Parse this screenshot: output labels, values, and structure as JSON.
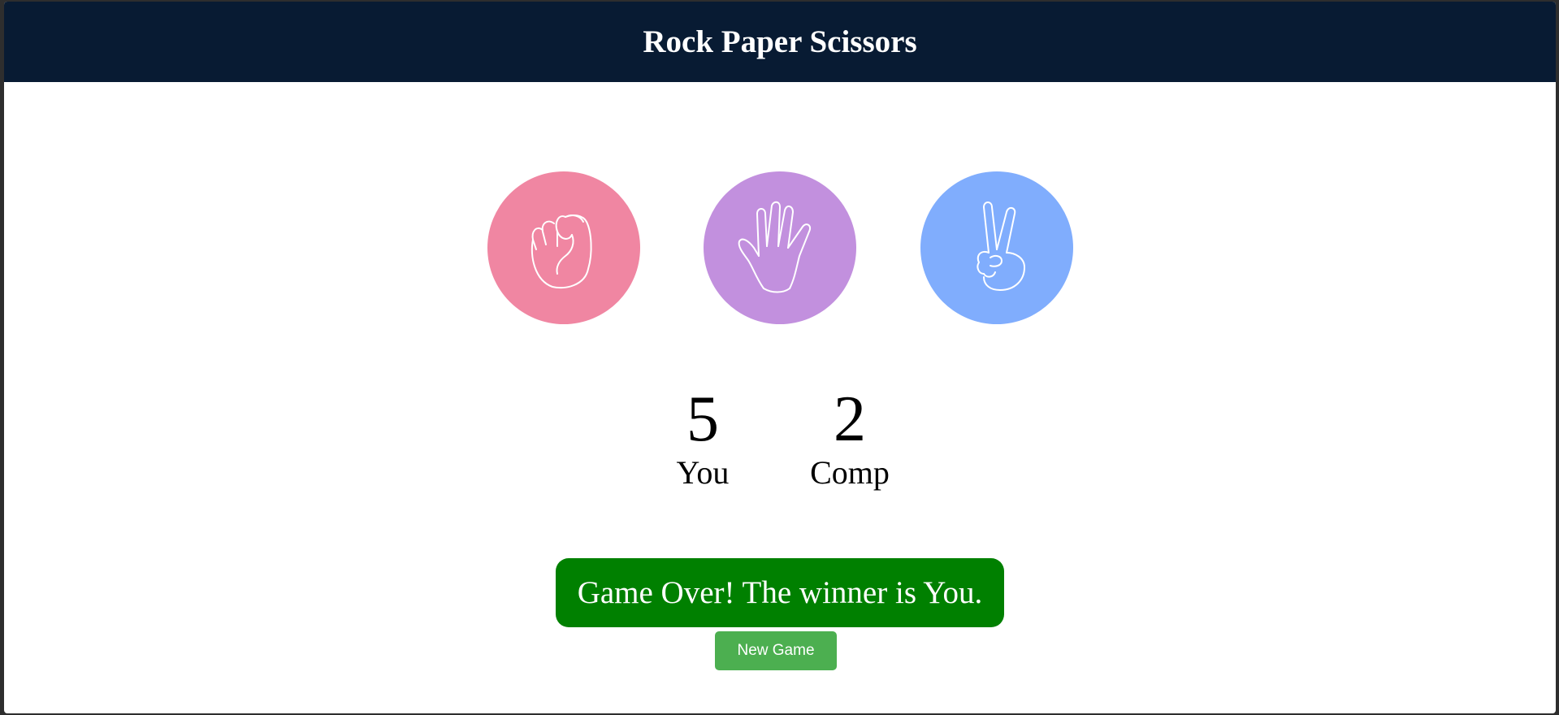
{
  "header": {
    "title": "Rock Paper Scissors",
    "background": "#081b33"
  },
  "choices": [
    {
      "id": "rock",
      "icon": "rock-fist-icon",
      "color": "#f086a2"
    },
    {
      "id": "paper",
      "icon": "paper-hand-icon",
      "color": "#c290de"
    },
    {
      "id": "scissors",
      "icon": "scissors-peace-icon",
      "color": "#80adfd"
    }
  ],
  "scoreboard": {
    "user": {
      "score": "5",
      "label": "You"
    },
    "computer": {
      "score": "2",
      "label": "Comp"
    }
  },
  "result": {
    "message": "Game Over! The winner is You.",
    "color": "#008000"
  },
  "new_game": {
    "label": "New Game",
    "color": "#4caf50"
  }
}
